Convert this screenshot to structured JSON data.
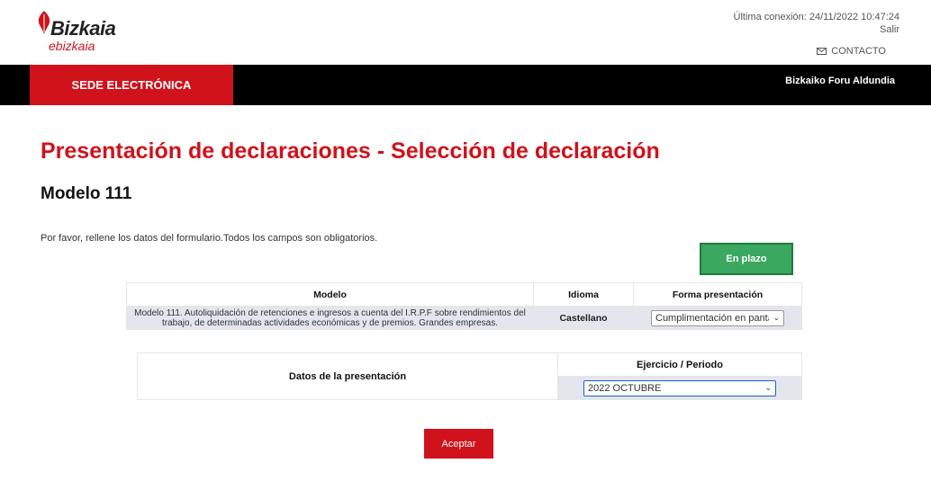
{
  "brand": {
    "name": "Bizkaia",
    "sub": "ebizkaia",
    "color": "#d0121b"
  },
  "session": {
    "last_connection": "Última conexión: 24/11/2022 10:47:24",
    "logout": "Salir"
  },
  "contact": {
    "label": "CONTACTO",
    "icon": "envelope-icon"
  },
  "nav": {
    "sede": "SEDE ELECTRÓNICA",
    "org": "Bizkaiko Foru Aldundia"
  },
  "page": {
    "title": "Presentación de declaraciones - Selección de declaración",
    "model_title": "Modelo 111",
    "instructions": "Por favor, rellene los datos del formulario.Todos los campos son obligatorios.",
    "status": "En plazo"
  },
  "declaration_table": {
    "headers": [
      "Modelo",
      "Idioma",
      "Forma presentación"
    ],
    "row": {
      "model": "Modelo 111. Autoliquidación de retenciones e ingresos a cuenta del I.R.P.F sobre rendimientos del trabajo, de determinadas actividades económicas y de premios. Grandes empresas.",
      "language": "Castellano",
      "form_value": "Cumplimentación en pantalla"
    }
  },
  "presentation": {
    "label": "Datos de la presentación",
    "period_header": "Ejercicio / Periodo",
    "period_value": "2022 OCTUBRE"
  },
  "actions": {
    "accept": "Aceptar"
  }
}
